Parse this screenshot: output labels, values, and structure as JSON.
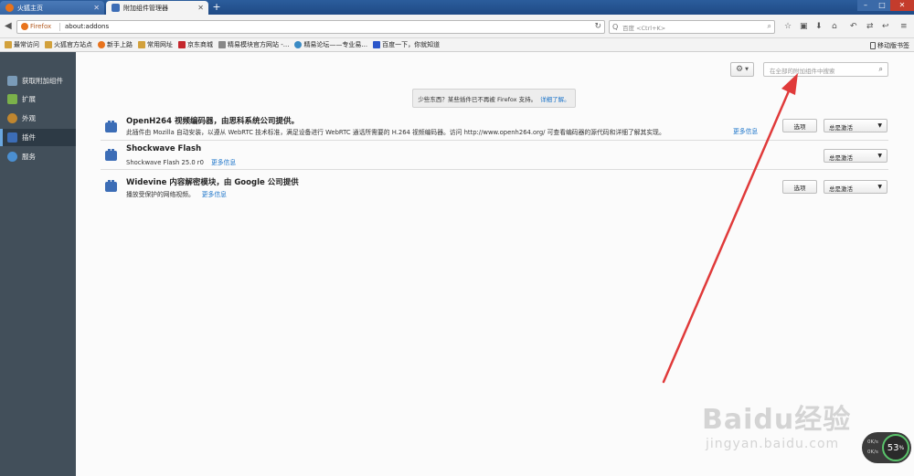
{
  "tabs": [
    {
      "label": "火狐主页",
      "icon": "firefox-icon"
    },
    {
      "label": "附加组件管理器",
      "icon": "puzzle-icon"
    }
  ],
  "url": {
    "identity": "Firefox",
    "address": "about:addons"
  },
  "search": {
    "placeholder": "百度 <Ctrl+K>"
  },
  "bookmarks": [
    {
      "label": "最常访问",
      "color": "#d2a13c"
    },
    {
      "label": "火狐官方站点",
      "color": "#d2a13c"
    },
    {
      "label": "新手上路",
      "color": "#e8731c"
    },
    {
      "label": "常用网址",
      "color": "#d2a13c"
    },
    {
      "label": "京东商城",
      "color": "#c4272d"
    },
    {
      "label": "精易模块官方网站 -...",
      "color": "#888888"
    },
    {
      "label": "精易论坛——专业易...",
      "color": "#3a8ac4"
    },
    {
      "label": "百度一下，你就知道",
      "color": "#2b56c9"
    }
  ],
  "mobile_bookmarks": "移动版书签",
  "sidebar": [
    {
      "label": "获取附加组件",
      "color": "#7a9bb8"
    },
    {
      "label": "扩展",
      "color": "#7bb14a"
    },
    {
      "label": "外观",
      "color": "#c0862f"
    },
    {
      "label": "插件",
      "color": "#3c6db6",
      "selected": true
    },
    {
      "label": "服务",
      "color": "#4b8fd1"
    }
  ],
  "addon_search": {
    "placeholder": "在全部的附加组件中搜索"
  },
  "notice": {
    "text": "少些东西？某些插件已不再被 Firefox 支持。",
    "link": "详细了解。"
  },
  "plugins": [
    {
      "name": "OpenH264 视频编码器，由思科系统公司提供。",
      "description": "此插件由 Mozilla 自动安装，以遵从 WebRTC 技术标准，满足设备进行 WebRTC 通话所需要的 H.264 视频编码器。访问 http://www.openh264.org/ 可查看编码器的源代码和详细了解其实现。",
      "more": "更多信息",
      "options": "选项",
      "state": "总是激活"
    },
    {
      "name": "Shockwave Flash",
      "description": "Shockwave Flash 25.0 r0",
      "more": "更多信息",
      "state": "总是激活"
    },
    {
      "name": "Widevine 内容解密模块，由 Google 公司提供",
      "description": "播放受保护的网络视频。",
      "more": "更多信息",
      "options": "选项",
      "state": "总是激活"
    }
  ],
  "watermark": {
    "brand": "Baidu经验",
    "url": "jingyan.baidu.com"
  },
  "speed_widget": {
    "up": "0K/s",
    "down": "0K/s",
    "percent": "53",
    "unit": "%"
  }
}
